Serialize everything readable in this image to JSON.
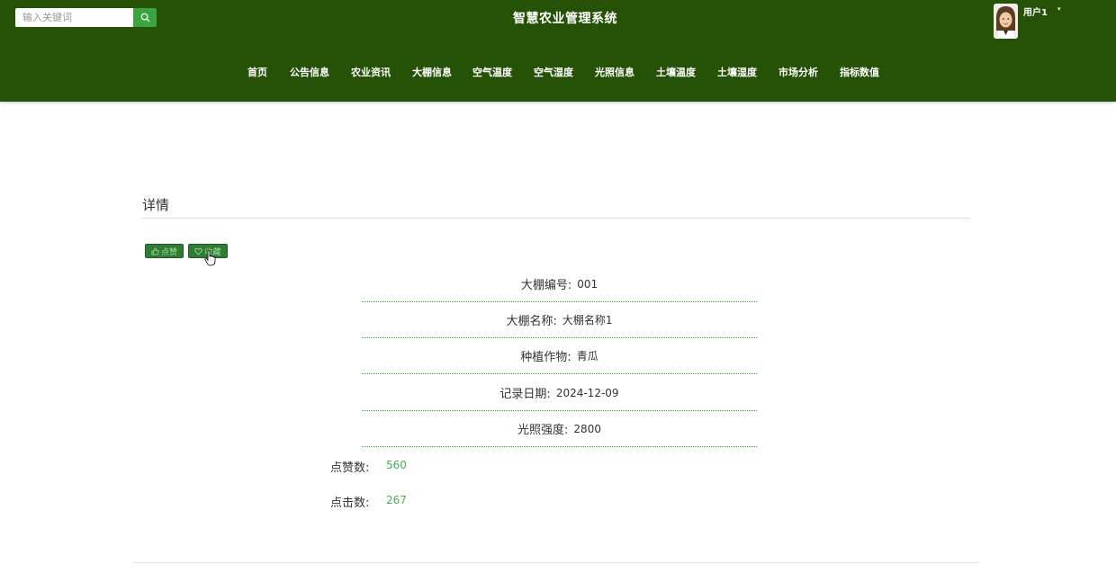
{
  "header": {
    "site_title": "智慧农业管理系统",
    "search_placeholder": "输入关键词",
    "user_name": "用户1",
    "user_caret": "▾",
    "nav_items": [
      "首页",
      "公告信息",
      "农业资讯",
      "大棚信息",
      "空气温度",
      "空气湿度",
      "光照信息",
      "土壤温度",
      "土壤湿度",
      "市场分析",
      "指标数值"
    ]
  },
  "detail": {
    "section_title": "详情",
    "like_button": "点赞",
    "favorite_button": "收藏",
    "fields": [
      {
        "label": "大棚编号:",
        "value": "001"
      },
      {
        "label": "大棚名称:",
        "value": "大棚名称1"
      },
      {
        "label": "种植作物:",
        "value": "青瓜"
      },
      {
        "label": "记录日期:",
        "value": "2024-12-09"
      },
      {
        "label": "光照强度:",
        "value": "2800"
      }
    ],
    "stats": [
      {
        "label": "点赞数:",
        "value": "560"
      },
      {
        "label": "点击数:",
        "value": "267"
      }
    ]
  },
  "colors": {
    "header_bg": "#265207",
    "accent": "#3aa53f",
    "button_bg": "#2e7d32",
    "stat_value": "#4caf50"
  },
  "icons": {
    "search": "search-icon",
    "like": "thumbs-up-icon",
    "favorite": "heart-icon",
    "cursor": "hand-pointer-icon"
  }
}
